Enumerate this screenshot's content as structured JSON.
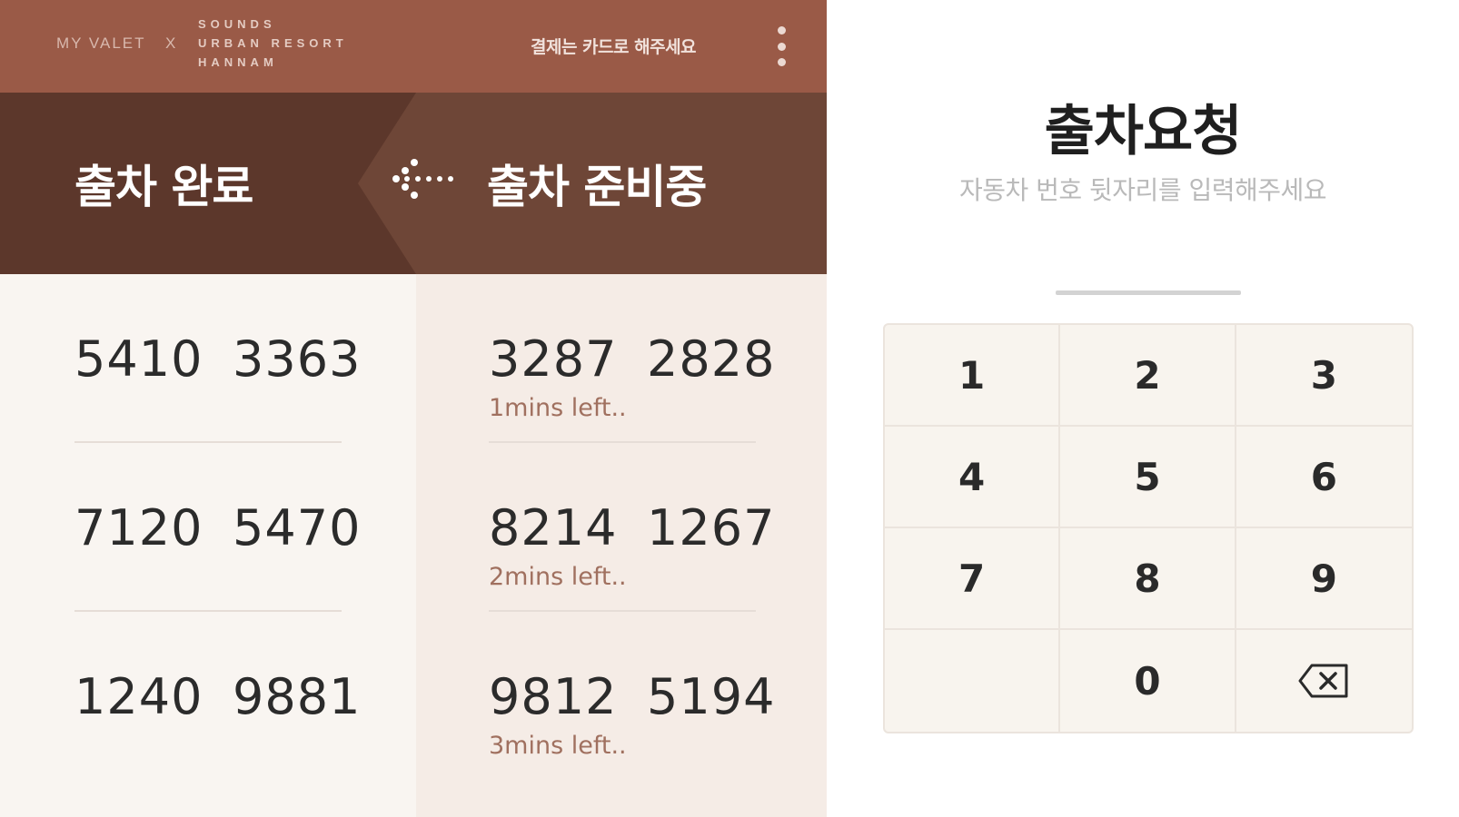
{
  "topbar": {
    "brand_left": "MY VALET",
    "brand_separator": "X",
    "brand_right_line1": "SOUNDS",
    "brand_right_line2": "URBAN RESORT",
    "brand_right_line3": "HANNAM",
    "payment_note": "결제는 카드로 해주세요",
    "menu_icon": "more-vertical-icon"
  },
  "tabs": {
    "done_label": "출차 완료",
    "preparing_label": "출차 준비중",
    "arrow_icon": "dotted-arrow-left-icon"
  },
  "done_list": {
    "rows": [
      {
        "left": "5410",
        "right": "3363"
      },
      {
        "left": "7120",
        "right": "5470"
      },
      {
        "left": "1240",
        "right": "9881"
      }
    ]
  },
  "preparing_list": {
    "rows": [
      {
        "left": "3287",
        "right": "2828",
        "eta": "1mins left.."
      },
      {
        "left": "8214",
        "right": "1267",
        "eta": "2mins left.."
      },
      {
        "left": "9812",
        "right": "5194",
        "eta": "3mins left.."
      }
    ]
  },
  "request": {
    "title": "출차요청",
    "subtitle": "자동차 번호 뒷자리를 입력해주세요",
    "input_value": ""
  },
  "keypad": {
    "keys": [
      "1",
      "2",
      "3",
      "4",
      "5",
      "6",
      "7",
      "8",
      "9",
      "",
      "0"
    ],
    "backspace_icon": "backspace-icon"
  },
  "colors": {
    "topbar": "#9a5a47",
    "header_done": "#5c372b",
    "header_preparing": "#6e4637",
    "list_done_bg": "#f9f5f1",
    "list_preparing_bg": "#f5ece6",
    "eta_text": "#a0705f",
    "keypad_bg": "#f8f4ee"
  }
}
